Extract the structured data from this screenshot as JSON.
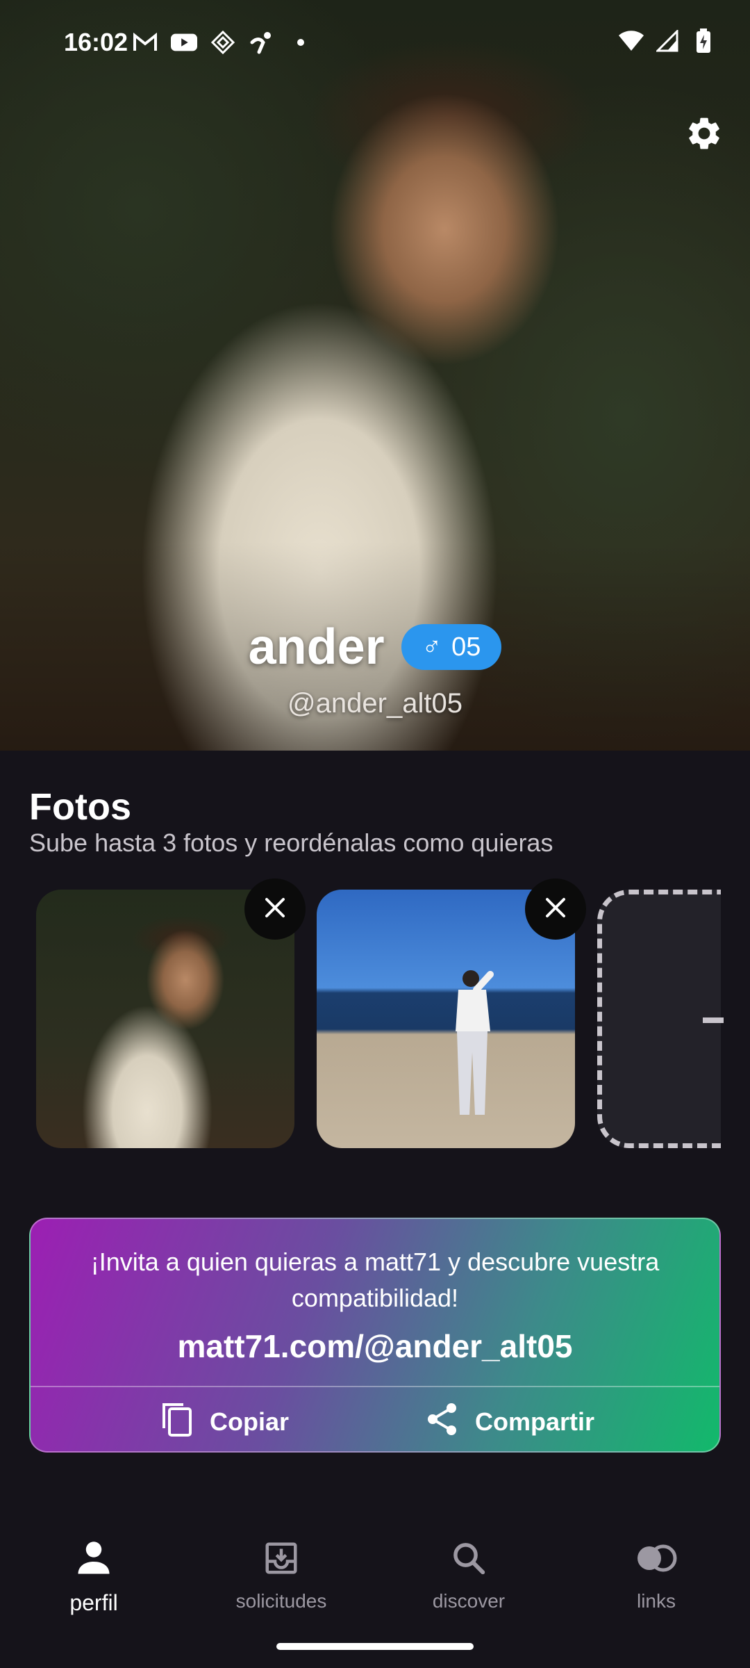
{
  "status_bar": {
    "time": "16:02",
    "left_icons": [
      "gmail-icon",
      "youtube-icon",
      "app-diamond-icon",
      "app-figure-icon",
      "dot-icon"
    ],
    "right_icons": [
      "wifi-icon",
      "signal-icon",
      "battery-charging-icon"
    ]
  },
  "profile": {
    "name": "ander",
    "gender_symbol": "♂",
    "badge_text": "05",
    "handle": "@ander_alt05"
  },
  "photos": {
    "title": "Fotos",
    "subtitle": "Sube hasta 3 fotos y reordénalas como quieras"
  },
  "invite": {
    "text": "¡Invita a quien quieras a matt71 y descubre vuestra compatibilidad!",
    "link": "matt71.com/@ander_alt05",
    "copy_label": "Copiar",
    "share_label": "Compartir"
  },
  "nav": {
    "items": [
      {
        "label": "perfil",
        "icon": "person-icon",
        "active": true
      },
      {
        "label": "solicitudes",
        "icon": "inbox-download-icon",
        "active": false
      },
      {
        "label": "discover",
        "icon": "search-icon",
        "active": false
      },
      {
        "label": "links",
        "icon": "links-circles-icon",
        "active": false
      }
    ]
  },
  "colors": {
    "background": "#15131a",
    "badge": "#2b96ee",
    "invite_gradient_start": "#9c1fb3",
    "invite_gradient_end": "#12b96b"
  }
}
